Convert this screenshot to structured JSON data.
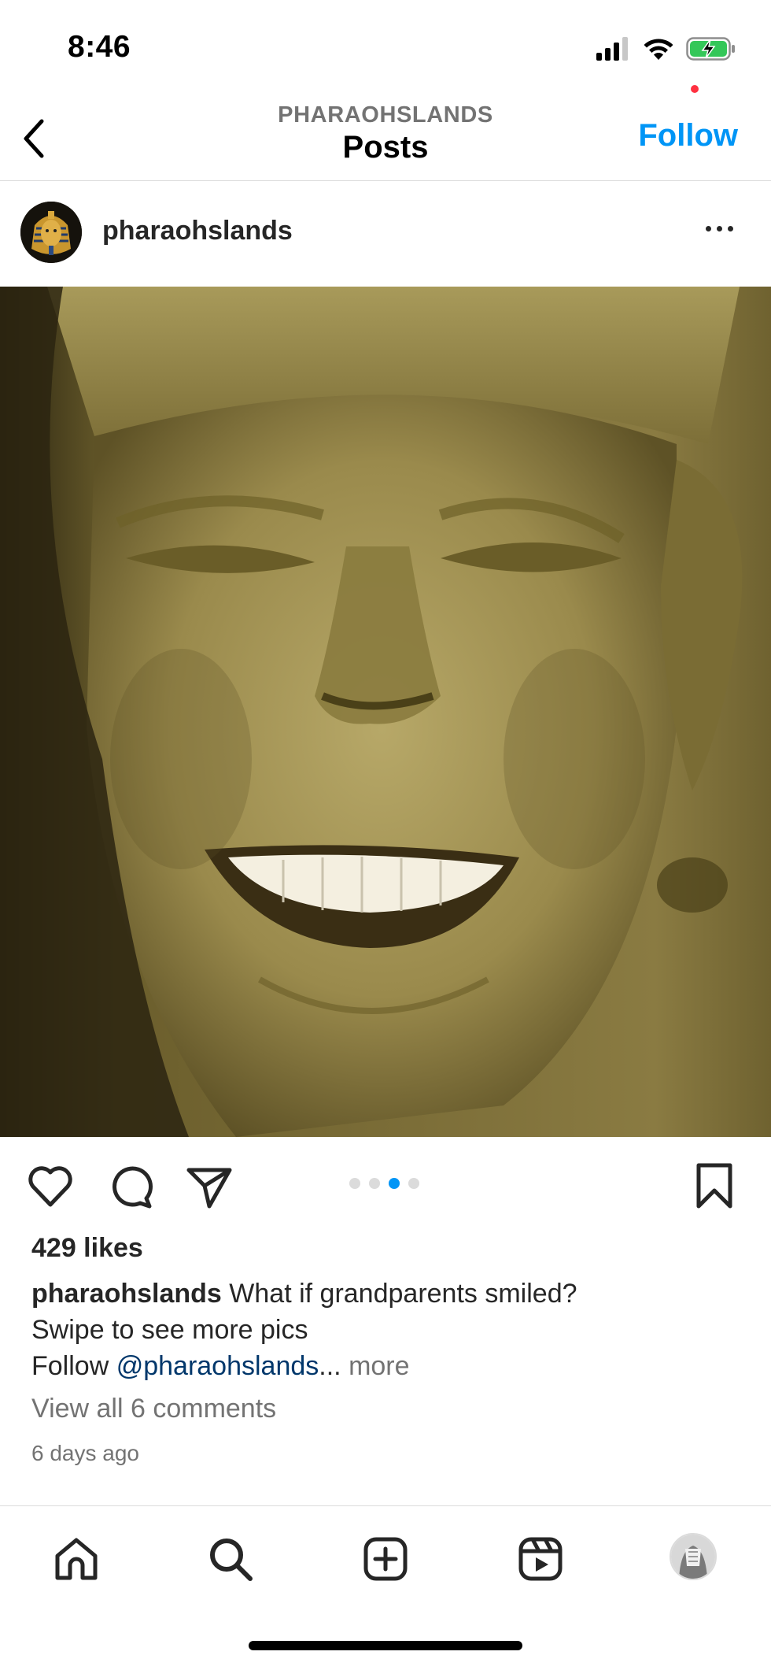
{
  "status_bar": {
    "time": "8:46",
    "icons": [
      "cellular-signal-icon",
      "wifi-icon",
      "battery-charging-icon"
    ]
  },
  "header": {
    "subtitle": "PHARAOHSLANDS",
    "title": "Posts",
    "follow_label": "Follow",
    "back_icon": "chevron-left-icon"
  },
  "post": {
    "username": "pharaohslands",
    "image_alt": "Sculpted pharaoh face edited to smile",
    "carousel": {
      "count": 4,
      "active_index": 2
    },
    "likes": "429 likes",
    "caption": {
      "user": "pharaohslands",
      "line1": " What if grandparents smiled?",
      "line2": "Swipe to see more pics",
      "line3_prefix": "Follow ",
      "mention": "@pharaohslands",
      "ellipsis": "...",
      "more": " more"
    },
    "view_comments": "View all 6 comments",
    "time": "6 days ago"
  },
  "tabbar": {
    "tabs": [
      "home-icon",
      "search-icon",
      "create-post-icon",
      "reels-icon",
      "profile-avatar"
    ],
    "notification": true
  },
  "colors": {
    "accent": "#0095f6",
    "mention": "#00376b",
    "secondary_text": "#737373",
    "divider": "#dbdbdb",
    "notification": "#ff3040"
  }
}
